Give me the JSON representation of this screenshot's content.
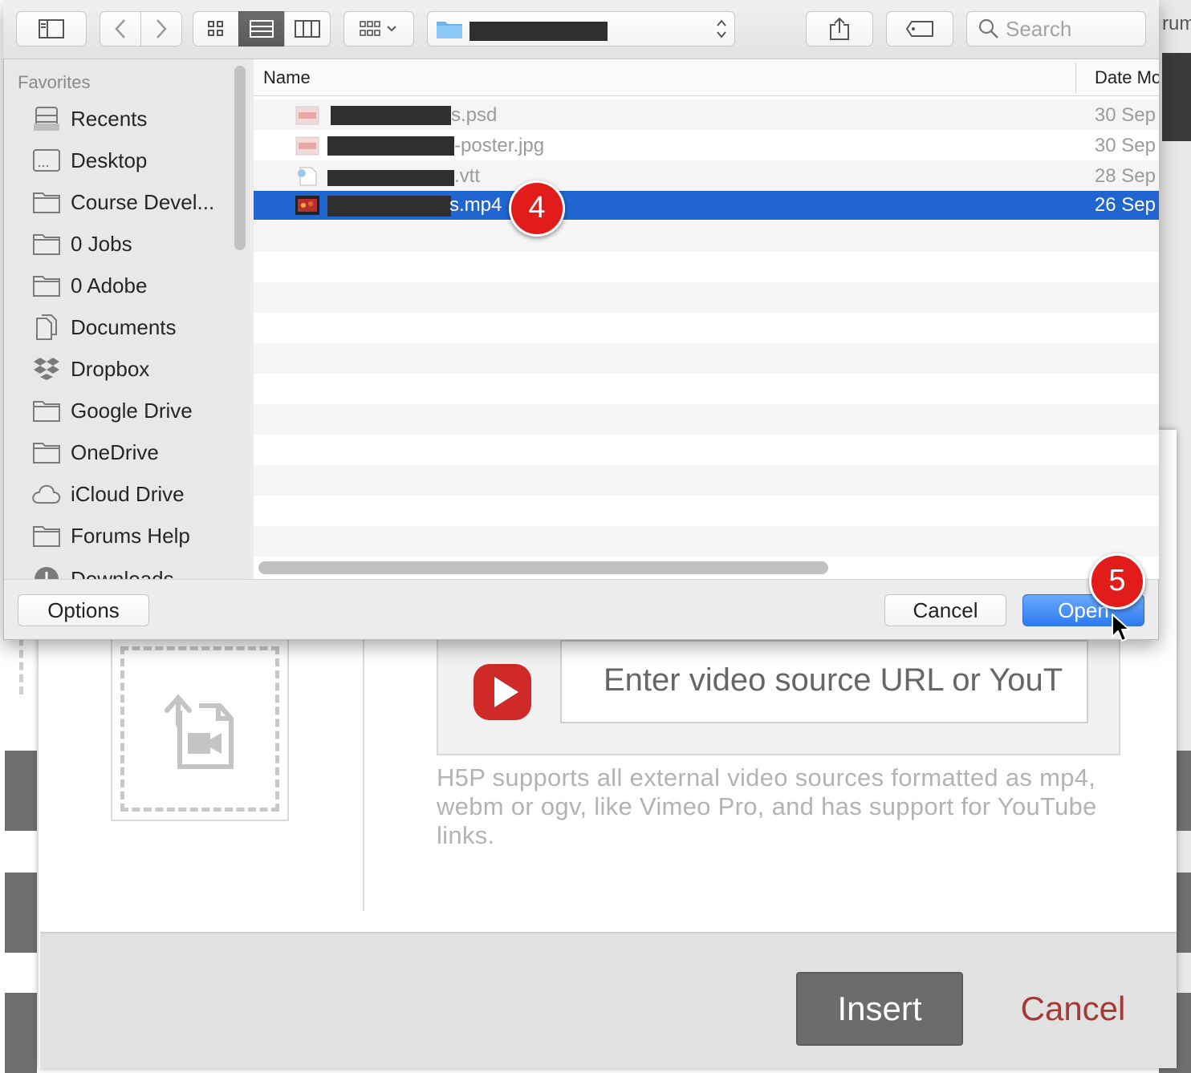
{
  "background_page": {
    "partial_label": "rum"
  },
  "h5p_modal": {
    "url_placeholder": "Enter video source URL or YouT",
    "help_text": "H5P supports all external video sources formatted as mp4, webm or ogv, like Vimeo Pro, and has support for YouTube links.",
    "insert_label": "Insert",
    "cancel_label": "Cancel",
    "accent_color": "#a33a36"
  },
  "toolbar": {
    "search_placeholder": "Search",
    "icons": [
      "sidebar-toggle-icon",
      "back-chevron-icon",
      "forward-chevron-icon",
      "icon-view-icon",
      "list-view-icon",
      "column-view-icon",
      "group-by-icon",
      "folder-icon",
      "path-stepper-icon",
      "share-icon",
      "tag-icon",
      "search-icon"
    ]
  },
  "sidebar": {
    "heading": "Favorites",
    "items": [
      {
        "label": "Recents",
        "icon": "recents-icon"
      },
      {
        "label": "Desktop",
        "icon": "desktop-icon"
      },
      {
        "label": "Course Devel...",
        "icon": "folder-icon"
      },
      {
        "label": "0 Jobs",
        "icon": "folder-icon"
      },
      {
        "label": "0 Adobe",
        "icon": "folder-icon"
      },
      {
        "label": "Documents",
        "icon": "documents-icon"
      },
      {
        "label": "Dropbox",
        "icon": "dropbox-icon"
      },
      {
        "label": "Google Drive",
        "icon": "folder-icon"
      },
      {
        "label": "OneDrive",
        "icon": "folder-icon"
      },
      {
        "label": "iCloud Drive",
        "icon": "cloud-icon"
      },
      {
        "label": "Forums Help",
        "icon": "folder-icon"
      },
      {
        "label": "Downloads",
        "icon": "downloads-icon"
      }
    ]
  },
  "file_list": {
    "columns": {
      "name": "Name",
      "date": "Date Mo"
    },
    "files": [
      {
        "suffix": "s.psd",
        "date": "30 Sep",
        "selected": false
      },
      {
        "suffix": "-poster.jpg",
        "date": "30 Sep",
        "selected": false
      },
      {
        "suffix": ".vtt",
        "date": "28 Sep",
        "selected": false
      },
      {
        "suffix": "s.mp4",
        "date": "26 Sep",
        "selected": true
      }
    ],
    "selection_color": "#2165d0"
  },
  "dialog_buttons": {
    "options_label": "Options",
    "cancel_label": "Cancel",
    "open_label": "Open"
  },
  "annotations": {
    "step4": "4",
    "step5": "5",
    "color": "#e21b1b"
  }
}
